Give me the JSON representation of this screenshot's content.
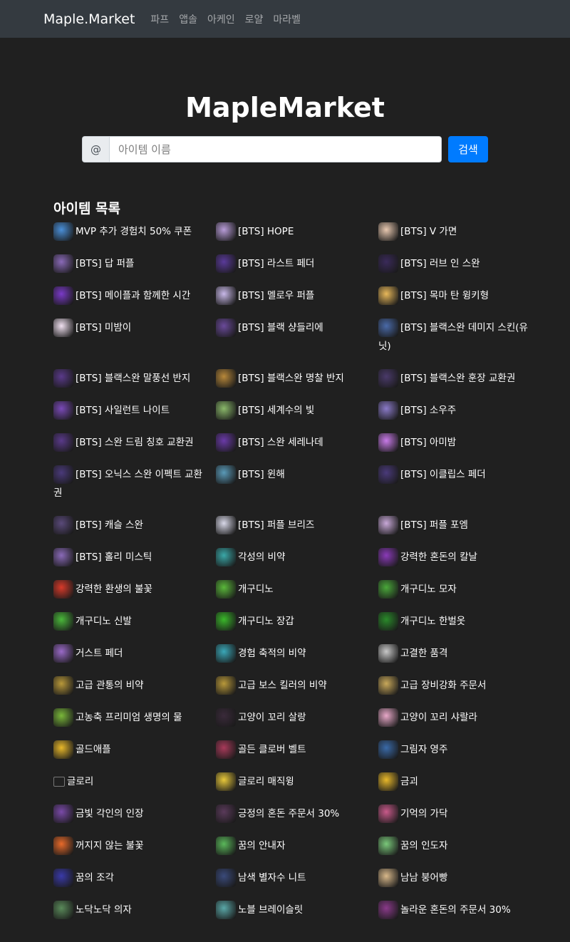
{
  "navbar": {
    "brand": "Maple.Market",
    "links": [
      "파프",
      "앱솔",
      "아케인",
      "로얄",
      "마라벨"
    ]
  },
  "hero": {
    "title": "MapleMarket",
    "addon": "@",
    "placeholder": "아이템 이름",
    "search_button": "검색"
  },
  "section_title": "아이템 목록",
  "items": [
    {
      "label": "MVP 추가 경험치 50% 쿠폰",
      "icon": "mvp-coupon-icon",
      "color": "#4a8fd8"
    },
    {
      "label": "[BTS] HOPE",
      "icon": "hope-card-icon",
      "color": "#b89cd8"
    },
    {
      "label": "[BTS] V 가면",
      "icon": "v-mask-icon",
      "color": "#e8c8b0"
    },
    {
      "label": "[BTS] 답 퍼플",
      "icon": "purple-shorts-icon",
      "color": "#8a6ab8"
    },
    {
      "label": "[BTS] 라스트 페더",
      "icon": "feather-icon",
      "color": "#5a3a9a"
    },
    {
      "label": "[BTS] 러브 인 스완",
      "icon": "swan-outfit-icon",
      "color": "#3a2a5a"
    },
    {
      "label": "[BTS] 메이플과 함께한 시간",
      "icon": "time-display-icon",
      "color": "#7a3ac8"
    },
    {
      "label": "[BTS] 멜로우 퍼플",
      "icon": "purple-hat-icon",
      "color": "#c8b8e8"
    },
    {
      "label": "[BTS] 목마 탄 윙키형",
      "icon": "winky-icon",
      "color": "#e8b85a"
    },
    {
      "label": "[BTS] 미밤이",
      "icon": "mibam-icon",
      "color": "#f0e0f0"
    },
    {
      "label": "[BTS] 블랙 샹들리에",
      "icon": "chandelier-icon",
      "color": "#6a4a9a"
    },
    {
      "label": "[BTS] 블랙스완 데미지 스킨(유닛)",
      "icon": "damage-skin-icon",
      "color": "#4a6aa8"
    },
    {
      "label": "[BTS] 블랙스완 말풍선 반지",
      "icon": "ring-icon",
      "color": "#5a3a8a"
    },
    {
      "label": "[BTS] 블랙스완 명찰 반지",
      "icon": "ring-icon",
      "color": "#b8883a"
    },
    {
      "label": "[BTS] 블랙스완 훈장 교환권",
      "icon": "medal-ticket-icon",
      "color": "#4a3a6a"
    },
    {
      "label": "[BTS] 사일런트 나이트",
      "icon": "silent-night-icon",
      "color": "#7a4ab8"
    },
    {
      "label": "[BTS] 세계수의 빛",
      "icon": "world-tree-icon",
      "color": "#8ab86a"
    },
    {
      "label": "[BTS] 소우주",
      "icon": "universe-icon",
      "color": "#8a7ac8"
    },
    {
      "label": "[BTS] 스완 드림 칭호 교환권",
      "icon": "title-ticket-icon",
      "color": "#5a3a8a"
    },
    {
      "label": "[BTS] 스완 세레나데",
      "icon": "serenade-icon",
      "color": "#6a3aa8"
    },
    {
      "label": "[BTS] 아미밤",
      "icon": "armybomb-icon",
      "color": "#c87ae8"
    },
    {
      "label": "[BTS] 오닉스 스완 이펙트 교환권",
      "icon": "effect-ticket-icon",
      "color": "#4a3a7a"
    },
    {
      "label": "[BTS] 윈해",
      "icon": "winhae-icon",
      "color": "#5a9ab8"
    },
    {
      "label": "[BTS] 이클립스 페더",
      "icon": "eclipse-feather-icon",
      "color": "#4a3a7a"
    },
    {
      "label": "[BTS] 캐슬 스완",
      "icon": "castle-icon",
      "color": "#5a4a7a"
    },
    {
      "label": "[BTS] 퍼플 브리즈",
      "icon": "sneakers-icon",
      "color": "#d8d8e8"
    },
    {
      "label": "[BTS] 퍼플 포엠",
      "icon": "jacket-icon",
      "color": "#c8a8d8"
    },
    {
      "label": "[BTS] 홀리 미스틱",
      "icon": "mystic-icon",
      "color": "#8a6ab8"
    },
    {
      "label": "각성의 비약",
      "icon": "potion-icon",
      "color": "#3aa8a8"
    },
    {
      "label": "강력한 혼돈의 칼날",
      "icon": "blade-icon",
      "color": "#8a3ab8"
    },
    {
      "label": "강력한 환생의 불꽃",
      "icon": "flame-icon",
      "color": "#d83a2a"
    },
    {
      "label": "개구디노",
      "icon": "frog-icon",
      "color": "#5ab83a"
    },
    {
      "label": "개구디노 모자",
      "icon": "frog-hat-icon",
      "color": "#4aa83a"
    },
    {
      "label": "개구디노 신발",
      "icon": "frog-shoes-icon",
      "color": "#4ab83a"
    },
    {
      "label": "개구디노 장갑",
      "icon": "frog-gloves-icon",
      "color": "#3ab82a"
    },
    {
      "label": "개구디노 한벌옷",
      "icon": "frog-suit-icon",
      "color": "#2a8a2a"
    },
    {
      "label": "거스트 페더",
      "icon": "gust-feather-icon",
      "color": "#9a6ac8"
    },
    {
      "label": "경험 축적의 비약",
      "icon": "exp-potion-icon",
      "color": "#3aa8b8"
    },
    {
      "label": "고결한 품격",
      "icon": "noble-icon",
      "color": "#c8c8c8"
    },
    {
      "label": "고급 관통의 비약",
      "icon": "pierce-potion-icon",
      "color": "#b8983a"
    },
    {
      "label": "고급 보스 킬러의 비약",
      "icon": "boss-potion-icon",
      "color": "#b8983a"
    },
    {
      "label": "고급 장비강화 주문서",
      "icon": "scroll-icon",
      "color": "#c8a85a"
    },
    {
      "label": "고농축 프리미엄 생명의 물",
      "icon": "water-icon",
      "color": "#7ab83a"
    },
    {
      "label": "고양이 꼬리 살랑",
      "icon": "cat-tail-icon",
      "color": "#3a2a3a"
    },
    {
      "label": "고양이 꼬리 샤랄라",
      "icon": "cat-tail-pink-icon",
      "color": "#e8a8c8"
    },
    {
      "label": "골드애플",
      "icon": "gold-apple-icon",
      "color": "#e8b82a"
    },
    {
      "label": "골든 클로버 벨트",
      "icon": "belt-icon",
      "color": "#a83a5a"
    },
    {
      "label": "그림자 영주",
      "icon": "shadow-lord-icon",
      "color": "#3a6aa8"
    },
    {
      "label": "글로리",
      "icon": "broken-image-icon",
      "color": ""
    },
    {
      "label": "글로리 매직윙",
      "icon": "glory-wing-icon",
      "color": "#e8c83a"
    },
    {
      "label": "금괴",
      "icon": "gold-bar-icon",
      "color": "#e8b82a"
    },
    {
      "label": "금빛 각인의 인장",
      "icon": "seal-icon",
      "color": "#7a4aa8"
    },
    {
      "label": "긍정의 혼돈 주문서 30%",
      "icon": "chaos-scroll-icon",
      "color": "#5a3a5a"
    },
    {
      "label": "기억의 가닥",
      "icon": "memory-thread-icon",
      "color": "#c85a8a"
    },
    {
      "label": "꺼지지 않는 불꽃",
      "icon": "eternal-flame-icon",
      "color": "#e86a2a"
    },
    {
      "label": "꿈의 안내자",
      "icon": "dream-guide-icon",
      "color": "#5ab85a"
    },
    {
      "label": "꿈의 인도자",
      "icon": "dream-leader-icon",
      "color": "#7ac87a"
    },
    {
      "label": "꿈의 조각",
      "icon": "dream-piece-icon",
      "color": "#3a3aa8"
    },
    {
      "label": "남색 별자수 니트",
      "icon": "knit-icon",
      "color": "#3a4a7a"
    },
    {
      "label": "남남 붕어빵",
      "icon": "fish-bread-icon",
      "color": "#d8b88a"
    },
    {
      "label": "노닥노닥 의자",
      "icon": "chair-icon",
      "color": "#5a8a5a"
    },
    {
      "label": "노블 브레이슬릿",
      "icon": "bracelet-icon",
      "color": "#5aa8a8"
    },
    {
      "label": "놀라운 혼돈의 주문서 30%",
      "icon": "scroll-chaos-icon",
      "color": "#8a3a8a"
    }
  ]
}
